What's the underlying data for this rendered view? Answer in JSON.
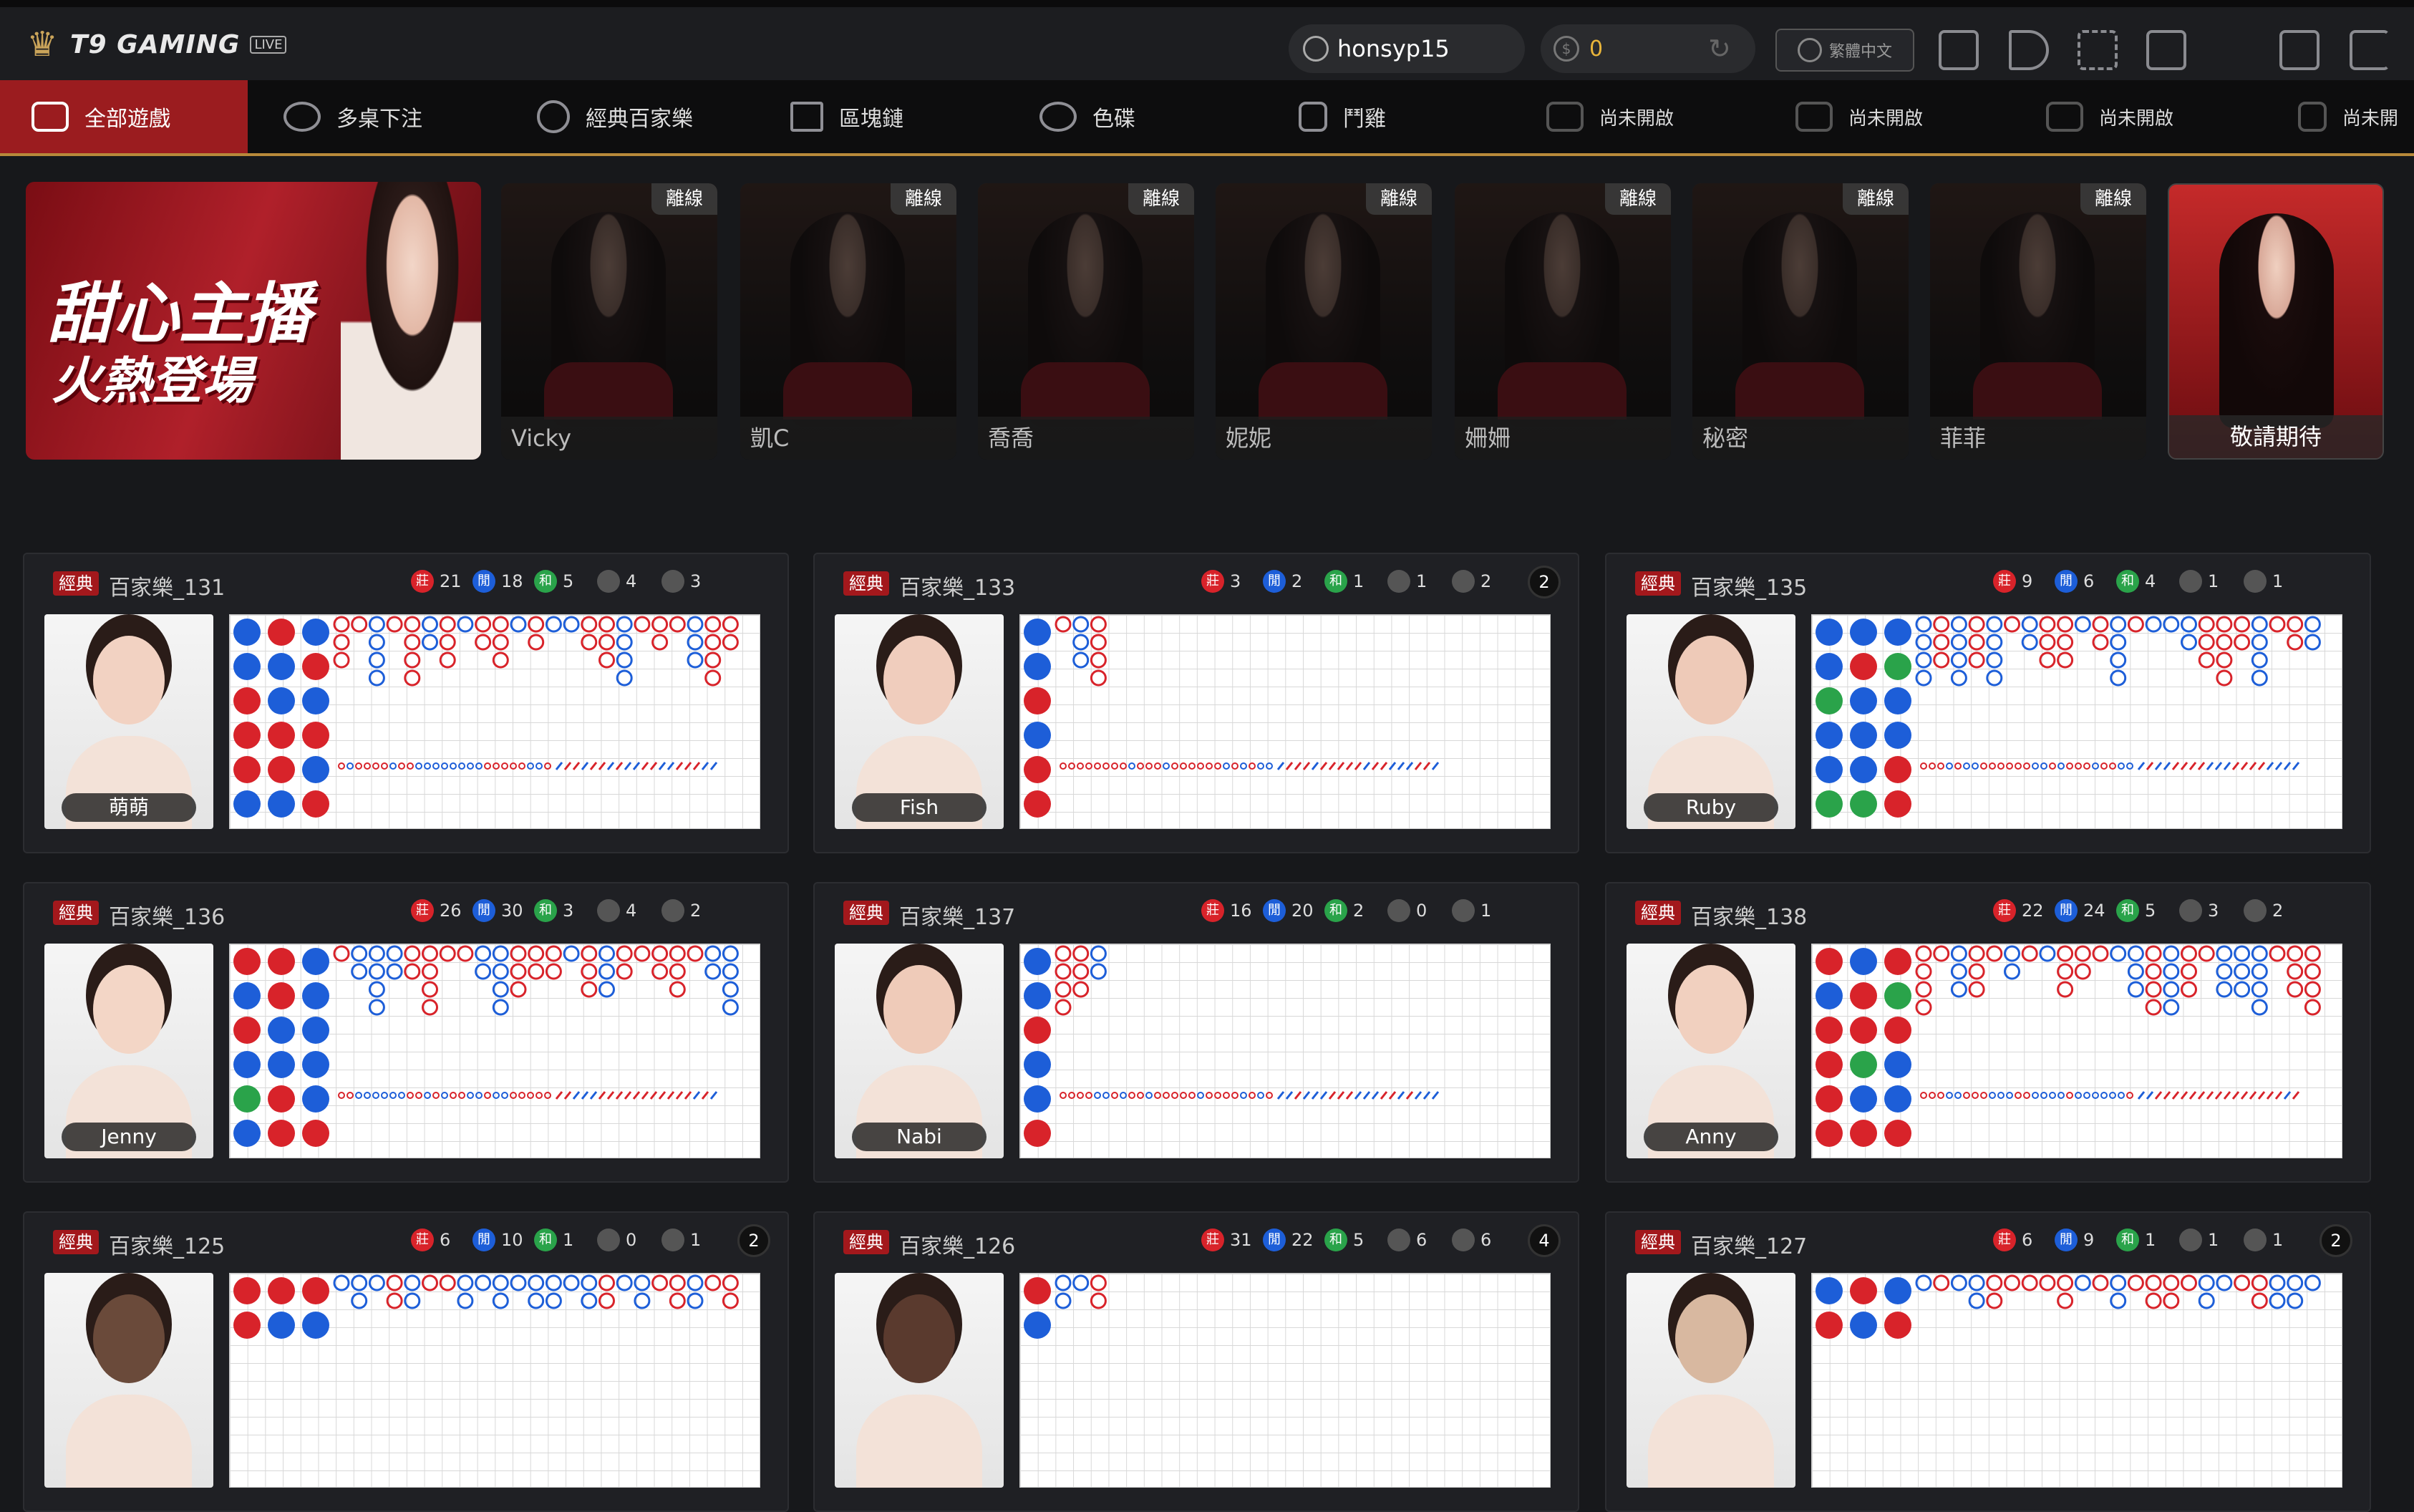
{
  "brand": {
    "name": "T9 GAMING",
    "live": "LIVE"
  },
  "header": {
    "username": "honsyp15",
    "balance": "0",
    "language": "繁體中文"
  },
  "nav": [
    {
      "label": "全部遊戲",
      "active": true
    },
    {
      "label": "多桌下注"
    },
    {
      "label": "經典百家樂"
    },
    {
      "label": "區塊鏈"
    },
    {
      "label": "色碟"
    },
    {
      "label": "鬥雞"
    },
    {
      "label": "尚未開啟"
    },
    {
      "label": "尚未開啟"
    },
    {
      "label": "尚未開啟"
    },
    {
      "label": "尚未開"
    }
  ],
  "banner": {
    "line1": "甜心主播",
    "line2": "火熱登場"
  },
  "hosts": [
    {
      "name": "Vicky",
      "status": "離線"
    },
    {
      "name": "凱C",
      "status": "離線"
    },
    {
      "name": "喬喬",
      "status": "離線"
    },
    {
      "name": "妮妮",
      "status": "離線"
    },
    {
      "name": "姍姍",
      "status": "離線"
    },
    {
      "name": "秘密",
      "status": "離線"
    },
    {
      "name": "菲菲",
      "status": "離線"
    },
    {
      "name": "敬請期待",
      "status": ""
    }
  ],
  "table_tag": "經典",
  "tables": [
    {
      "name": "百家樂_131",
      "dealer": "萌萌",
      "banker": "21",
      "player": "18",
      "tie": "5",
      "bpair": "4",
      "ppair": "3",
      "count": ""
    },
    {
      "name": "百家樂_133",
      "dealer": "Fish",
      "banker": "3",
      "player": "2",
      "tie": "1",
      "bpair": "1",
      "ppair": "2",
      "count": "2"
    },
    {
      "name": "百家樂_135",
      "dealer": "Ruby",
      "banker": "9",
      "player": "6",
      "tie": "4",
      "bpair": "1",
      "ppair": "1",
      "count": ""
    },
    {
      "name": "百家樂_136",
      "dealer": "Jenny",
      "banker": "26",
      "player": "30",
      "tie": "3",
      "bpair": "4",
      "ppair": "2",
      "count": ""
    },
    {
      "name": "百家樂_137",
      "dealer": "Nabi",
      "banker": "16",
      "player": "20",
      "tie": "2",
      "bpair": "0",
      "ppair": "1",
      "count": ""
    },
    {
      "name": "百家樂_138",
      "dealer": "Anny",
      "banker": "22",
      "player": "24",
      "tie": "5",
      "bpair": "3",
      "ppair": "2",
      "count": ""
    },
    {
      "name": "百家樂_125",
      "dealer": "",
      "banker": "6",
      "player": "10",
      "tie": "1",
      "bpair": "0",
      "ppair": "1",
      "count": "2"
    },
    {
      "name": "百家樂_126",
      "dealer": "",
      "banker": "31",
      "player": "22",
      "tie": "5",
      "bpair": "6",
      "ppair": "6",
      "count": "4"
    },
    {
      "name": "百家樂_127",
      "dealer": "",
      "banker": "6",
      "player": "9",
      "tie": "1",
      "bpair": "1",
      "ppair": "1",
      "count": "2"
    }
  ],
  "symbols": {
    "banker": "莊",
    "player": "閒",
    "tie": "和"
  },
  "colors": {
    "banker": "#d8232a",
    "player": "#1d5ed8",
    "tie": "#2aa34a",
    "accent": "#9b1c1f",
    "gold": "#b8893a"
  }
}
